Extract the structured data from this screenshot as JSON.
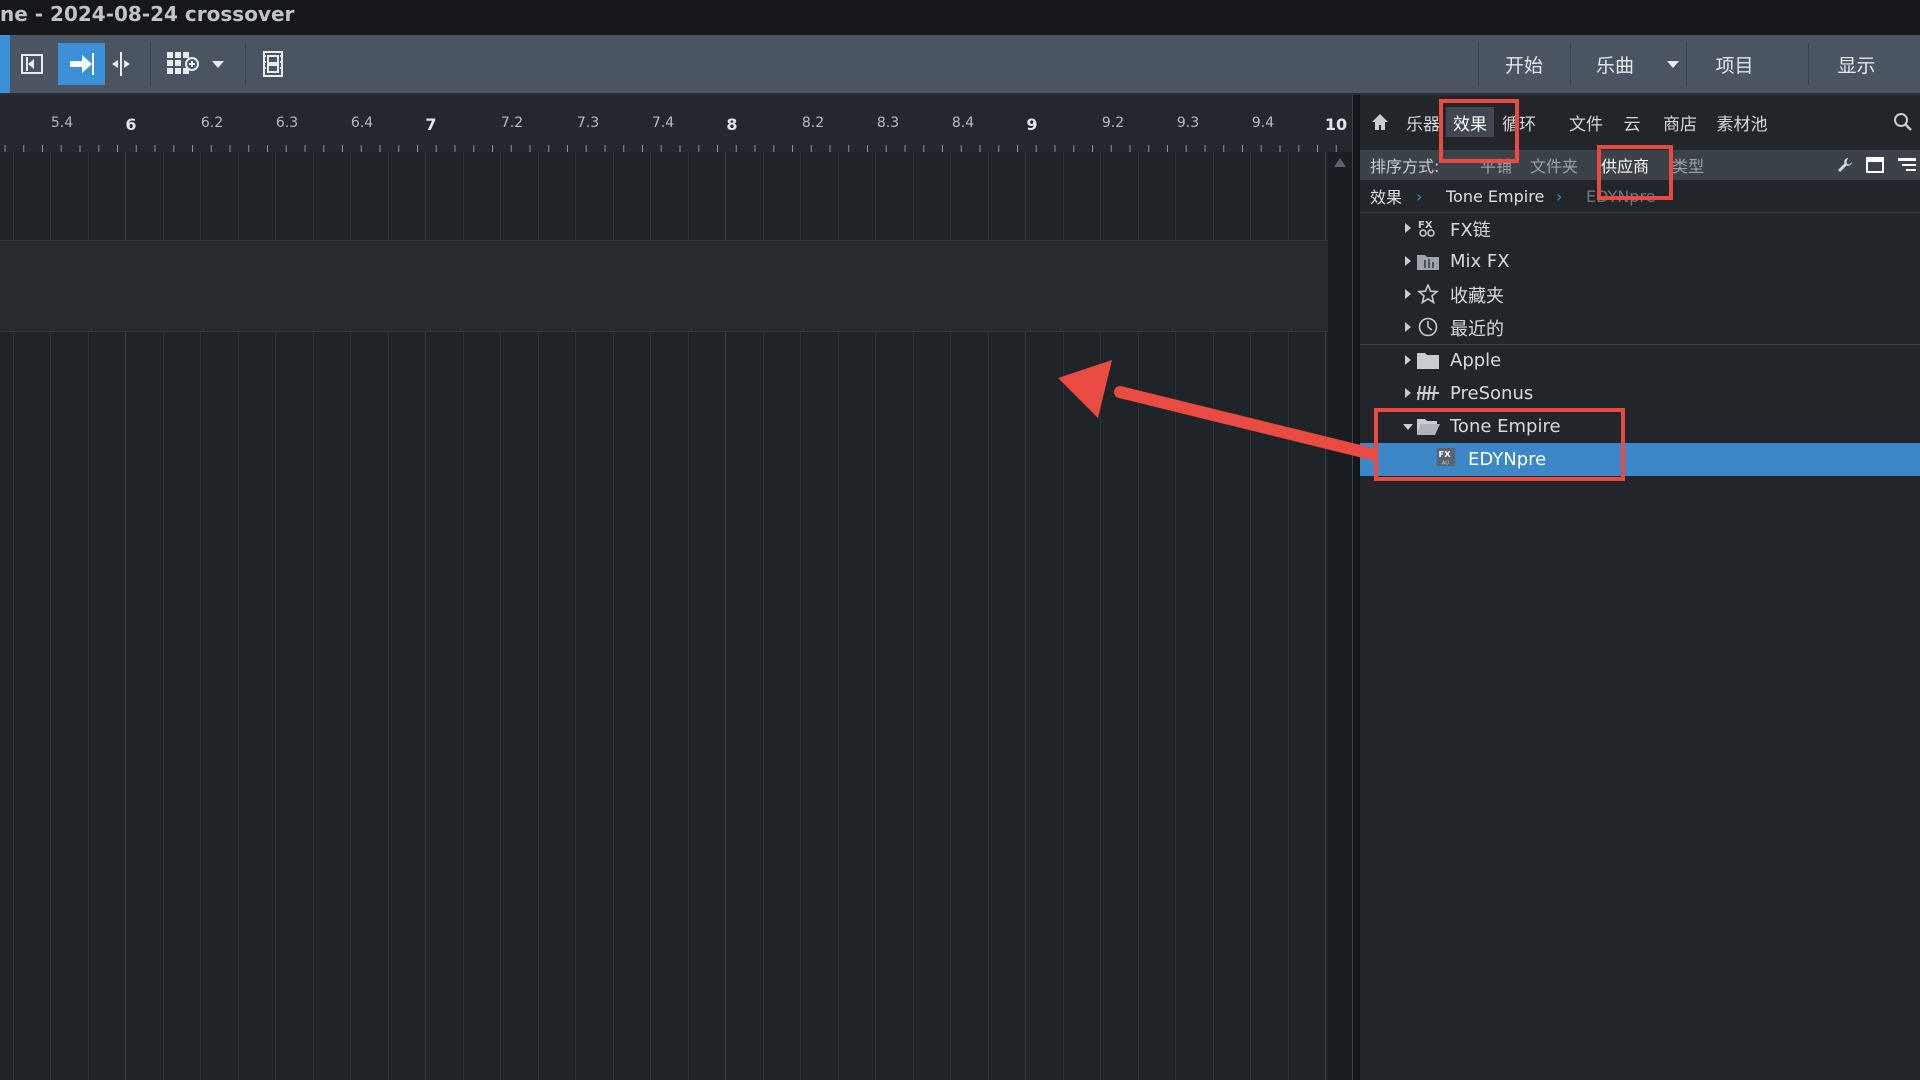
{
  "window": {
    "title": "ne - 2024-08-24 crossover"
  },
  "toolbar": {
    "icons": [
      "loop-start-icon",
      "arrow-right-icon",
      "split-icon",
      "grid-add-icon",
      "chevron-down-icon",
      "video-icon"
    ],
    "nav": {
      "start": "开始",
      "song": "乐曲",
      "project": "项目",
      "show": "显示"
    }
  },
  "ruler": {
    "labels": [
      "5.4",
      "6",
      "6.2",
      "6.3",
      "6.4",
      "7",
      "7.2",
      "7.3",
      "7.4",
      "8",
      "8.2",
      "8.3",
      "8.4",
      "9",
      "9.2",
      "9.3",
      "9.4",
      "10"
    ]
  },
  "browser": {
    "tabs": [
      "乐器",
      "效果",
      "循环",
      "文件",
      "云",
      "商店",
      "素材池"
    ],
    "active_tab": "效果",
    "sort": {
      "label": "排序方式:",
      "options": [
        "平铺",
        "文件夹",
        "供应商",
        "类型"
      ],
      "active": "供应商"
    },
    "breadcrumb": [
      "效果",
      "Tone Empire",
      "EDYNpre"
    ],
    "tree": [
      {
        "label": "FX链",
        "icon": "fx-chain-icon"
      },
      {
        "label": "Mix FX",
        "icon": "mixfx-icon"
      },
      {
        "label": "收藏夹",
        "icon": "star-icon"
      },
      {
        "label": "最近的",
        "icon": "clock-icon"
      },
      {
        "label": "Apple",
        "icon": "folder-icon"
      },
      {
        "label": "PreSonus",
        "icon": "presonus-icon"
      },
      {
        "label": "Tone Empire",
        "icon": "folder-open-icon",
        "expanded": true
      },
      {
        "label": "EDYNpre",
        "icon": "fx-au-icon",
        "selected": true
      }
    ]
  },
  "colors": {
    "accent": "#3a8fd6",
    "highlight": "#e94b43",
    "selection": "#3c87c8"
  }
}
